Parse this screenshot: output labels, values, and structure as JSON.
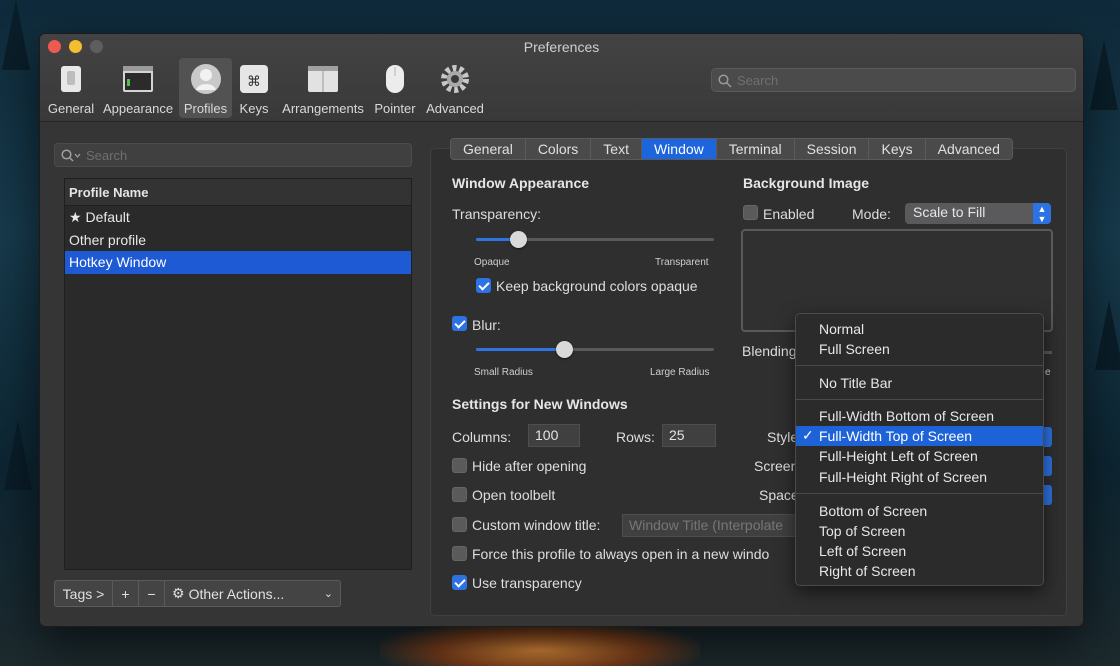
{
  "window": {
    "title": "Preferences"
  },
  "toolbar": {
    "items": [
      {
        "label": "General",
        "icon": "general-switch-icon",
        "selected": false
      },
      {
        "label": "Appearance",
        "icon": "appearance-window-icon",
        "selected": false
      },
      {
        "label": "Profiles",
        "icon": "profiles-person-icon",
        "selected": true
      },
      {
        "label": "Keys",
        "icon": "keys-command-icon",
        "selected": false
      },
      {
        "label": "Arrangements",
        "icon": "arrangements-window-icon",
        "selected": false
      },
      {
        "label": "Pointer",
        "icon": "pointer-mouse-icon",
        "selected": false
      },
      {
        "label": "Advanced",
        "icon": "advanced-gear-icon",
        "selected": false
      }
    ],
    "search_placeholder": "Search"
  },
  "sidebar": {
    "search_placeholder": "Search",
    "table_header": "Profile Name",
    "profiles": [
      {
        "name": "Default",
        "starred": true,
        "selected": false
      },
      {
        "name": "Other profile",
        "starred": false,
        "selected": false
      },
      {
        "name": "Hotkey Window",
        "starred": false,
        "selected": true
      }
    ],
    "bottom_bar": {
      "tags": "Tags >",
      "add": "+",
      "remove": "−",
      "other_actions": "Other Actions..."
    }
  },
  "tabs": [
    "General",
    "Colors",
    "Text",
    "Window",
    "Terminal",
    "Session",
    "Keys",
    "Advanced"
  ],
  "active_tab": "Window",
  "window_appearance": {
    "title": "Window Appearance",
    "transparency_label": "Transparency:",
    "transparency_value": 0.18,
    "transparency_min_label": "Opaque",
    "transparency_max_label": "Transparent",
    "keep_bg_opaque": {
      "label": "Keep background colors opaque",
      "checked": true
    },
    "blur": {
      "label": "Blur:",
      "checked": true
    },
    "blur_value": 0.37,
    "blur_min_label": "Small Radius",
    "blur_max_label": "Large Radius"
  },
  "background_image": {
    "title": "Background Image",
    "enabled": {
      "label": "Enabled",
      "checked": false
    },
    "mode_label": "Mode:",
    "mode_value": "Scale to Fill",
    "blending_label": "Blending",
    "blending_suffix": "e"
  },
  "new_windows": {
    "title": "Settings for New Windows",
    "columns_label": "Columns:",
    "columns_value": "100",
    "rows_label": "Rows:",
    "rows_value": "25",
    "style_label": "Style",
    "screen_label": "Screen",
    "space_label": "Space",
    "hide_after_opening": {
      "label": "Hide after opening",
      "checked": false
    },
    "open_toolbelt": {
      "label": "Open toolbelt",
      "checked": false
    },
    "custom_title": {
      "label": "Custom window title:",
      "checked": false,
      "placeholder": "Window Title (Interpolate"
    },
    "force_new_window": {
      "label": "Force this profile to always open in a new windo",
      "checked": false
    },
    "use_transparency": {
      "label": "Use transparency",
      "checked": true
    }
  },
  "style_menu": {
    "groups": [
      [
        "Normal",
        "Full Screen"
      ],
      [
        "No Title Bar"
      ],
      [
        "Full-Width Bottom of Screen",
        "Full-Width Top of Screen",
        "Full-Height Left of Screen",
        "Full-Height Right of Screen"
      ],
      [
        "Bottom of Screen",
        "Top of Screen",
        "Left of Screen",
        "Right of Screen"
      ]
    ],
    "selected": "Full-Width Top of Screen",
    "check_glyph": "✓"
  },
  "colors": {
    "accent": "#1e62d8",
    "window_bg": "#353536"
  }
}
